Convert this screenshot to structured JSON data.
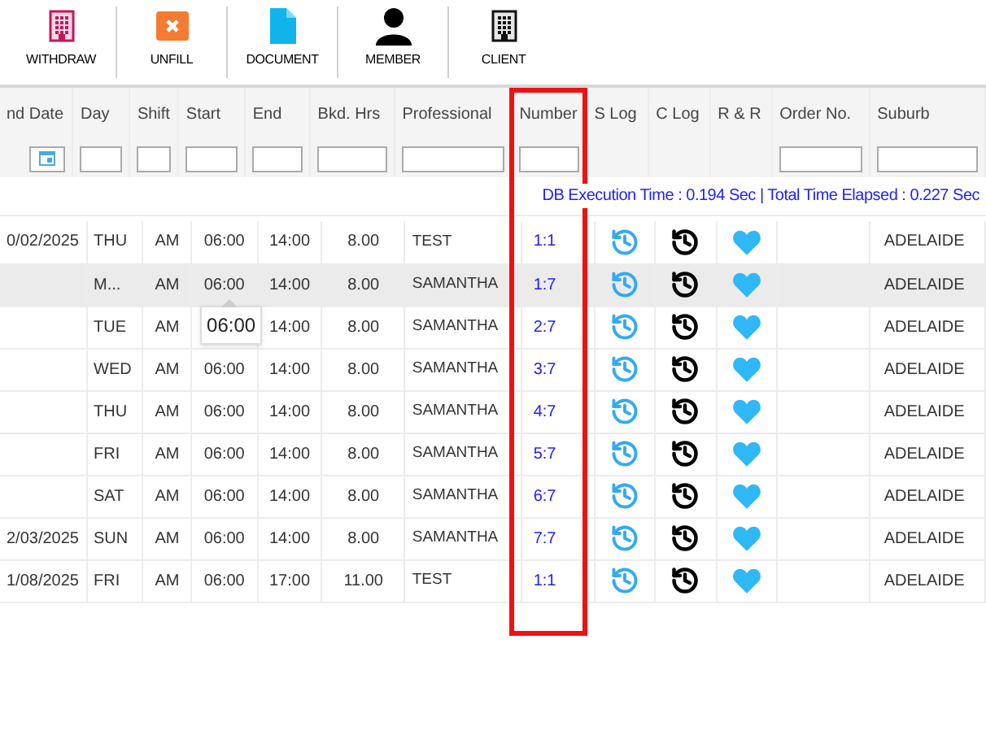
{
  "toolbar": [
    {
      "label": "WITHDRAW",
      "kind": "withdraw"
    },
    {
      "label": "UNFILL",
      "kind": "unfill"
    },
    {
      "label": "DOCUMENT",
      "kind": "document"
    },
    {
      "label": "MEMBER",
      "kind": "member"
    },
    {
      "label": "CLIENT",
      "kind": "client"
    }
  ],
  "columns": [
    {
      "label": "nd Date",
      "kind": "date",
      "highlighted": false
    },
    {
      "label": "Day",
      "kind": "text",
      "highlighted": false
    },
    {
      "label": "Shift",
      "kind": "text",
      "highlighted": false
    },
    {
      "label": "Start",
      "kind": "text",
      "highlighted": false
    },
    {
      "label": "End",
      "kind": "text",
      "highlighted": false
    },
    {
      "label": "Bkd. Hrs",
      "kind": "text",
      "highlighted": false
    },
    {
      "label": "Professional",
      "kind": "text",
      "highlighted": false
    },
    {
      "label": "Number",
      "kind": "text",
      "highlighted": true
    },
    {
      "label": "S Log",
      "kind": "none",
      "highlighted": false
    },
    {
      "label": "C Log",
      "kind": "none",
      "highlighted": false
    },
    {
      "label": "R & R",
      "kind": "none",
      "highlighted": false
    },
    {
      "label": "Order No.",
      "kind": "text",
      "highlighted": false
    },
    {
      "label": "Suburb",
      "kind": "text",
      "highlighted": false
    }
  ],
  "status": "DB Execution Time : 0.194 Sec | Total Time Elapsed : 0.227 Sec",
  "rows": [
    {
      "end_date": "0/02/2025",
      "day": "THU",
      "shift": "AM",
      "start": "06:00",
      "end": "14:00",
      "hours": "8.00",
      "professional": "TEST",
      "number": "1:1",
      "suburb": "ADELAIDE",
      "selected": false
    },
    {
      "day": "M...",
      "shift": "AM",
      "start": "06:00",
      "start_tooltip": "06:00",
      "end": "14:00",
      "hours": "8.00",
      "professional": "SAMANTHA",
      "number": "1:7",
      "suburb": "ADELAIDE",
      "selected": true
    },
    {
      "day": "TUE",
      "shift": "AM",
      "end": "14:00",
      "hours": "8.00",
      "professional": "SAMANTHA",
      "number": "2:7",
      "suburb": "ADELAIDE",
      "selected": false
    },
    {
      "day": "WED",
      "shift": "AM",
      "start": "06:00",
      "end": "14:00",
      "hours": "8.00",
      "professional": "SAMANTHA",
      "number": "3:7",
      "suburb": "ADELAIDE",
      "selected": false
    },
    {
      "day": "THU",
      "shift": "AM",
      "start": "06:00",
      "end": "14:00",
      "hours": "8.00",
      "professional": "SAMANTHA",
      "number": "4:7",
      "suburb": "ADELAIDE",
      "selected": false
    },
    {
      "day": "FRI",
      "shift": "AM",
      "start": "06:00",
      "end": "14:00",
      "hours": "8.00",
      "professional": "SAMANTHA",
      "number": "5:7",
      "suburb": "ADELAIDE",
      "selected": false
    },
    {
      "day": "SAT",
      "shift": "AM",
      "start": "06:00",
      "end": "14:00",
      "hours": "8.00",
      "professional": "SAMANTHA",
      "number": "6:7",
      "suburb": "ADELAIDE",
      "selected": false
    },
    {
      "end_date": "2/03/2025",
      "day": "SUN",
      "shift": "AM",
      "start": "06:00",
      "end": "14:00",
      "hours": "8.00",
      "professional": "SAMANTHA",
      "number": "7:7",
      "suburb": "ADELAIDE",
      "selected": false
    },
    {
      "end_date": "1/08/2025",
      "day": "FRI",
      "shift": "AM",
      "start": "06:00",
      "end": "17:00",
      "hours": "11.00",
      "professional": "TEST",
      "number": "1:1",
      "suburb": "ADELAIDE",
      "selected": false
    }
  ]
}
